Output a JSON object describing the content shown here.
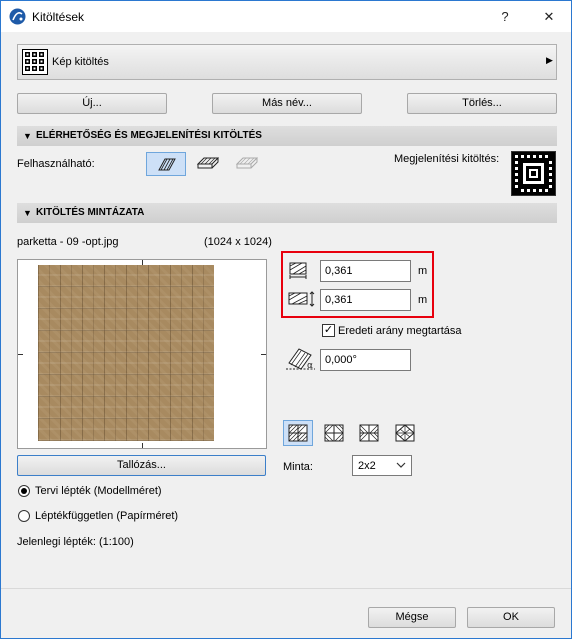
{
  "window": {
    "title": "Kitöltések",
    "help": "?",
    "close": "✕"
  },
  "fill_selector": {
    "name": "Kép kitöltés"
  },
  "buttons": {
    "new": "Új...",
    "rename": "Más név...",
    "delete": "Törlés..."
  },
  "availability": {
    "header": "ELÉRHETŐSÉG ÉS MEGJELENÍTÉSI KITÖLTÉS",
    "usable_label": "Felhasználható:",
    "display_fill_label": "Megjelenítési kitöltés:"
  },
  "pattern": {
    "header": "KITÖLTÉS MINTÁZATA",
    "file_name": "parketta - 09 -opt.jpg",
    "resolution": "(1024 x 1024)",
    "width_value": "0,361",
    "height_value": "0,361",
    "unit": "m",
    "keep_ratio_label": "Eredeti arány megtartása",
    "keep_ratio_checked": true,
    "angle_value": "0,000°",
    "browse_label": "Tallózás...",
    "pattern_label": "Minta:",
    "pattern_value": "2x2"
  },
  "scale": {
    "model_label": "Tervi lépték (Modellméret)",
    "paper_label": "Léptékfüggetlen (Papírméret)",
    "current_scale": "Jelenlegi lépték: (1:100)"
  },
  "footer": {
    "cancel": "Mégse",
    "ok": "OK"
  },
  "colors": {
    "highlight_box": "#e8000e",
    "selected_bg": "#cde0f7",
    "window_border": "#2b78d0"
  }
}
